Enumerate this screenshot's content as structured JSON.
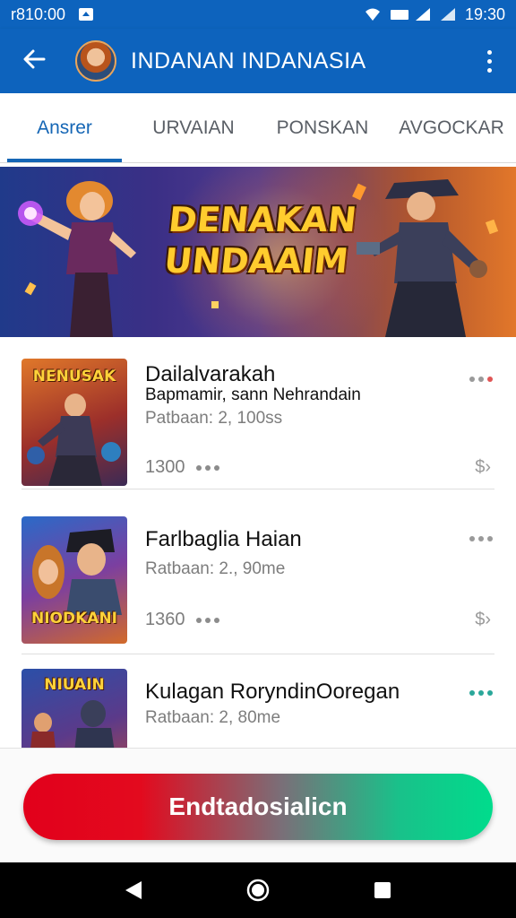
{
  "status_bar": {
    "time_left": "r810:00",
    "time_right": "19:30"
  },
  "app_bar": {
    "title": "INDANAN  INDANASIA"
  },
  "tabs": [
    {
      "label": "Ansrer"
    },
    {
      "label": "URVAIAN"
    },
    {
      "label": "PONSKAN"
    },
    {
      "label": "AVGOCKAR"
    }
  ],
  "banner": {
    "title_line1": "DENAKAN",
    "title_line2": "UNDAAIM"
  },
  "items": [
    {
      "thumb_title": "NENUSAK",
      "name": "Dailalvarakah",
      "subtitle": "Bapmamir, sann Nehrandain",
      "meta": "Patbaan: 2, 100ss",
      "count": "1300",
      "price_symbol": "$",
      "menu_color": "#e05555"
    },
    {
      "thumb_title": "NIODKANI",
      "name": "Farlbaglia Haian",
      "subtitle": "",
      "meta": "Ratbaan: 2., 90me",
      "count": "1360",
      "price_symbol": "$",
      "menu_color": "#9a9a9a"
    },
    {
      "thumb_title": "NIUAIN",
      "name": "Kulagan RoryndinOoregan",
      "subtitle": "",
      "meta": "Ratbaan: 2, 80me",
      "count": "",
      "price_symbol": "",
      "menu_color": "#2aa79a"
    }
  ],
  "cta": {
    "label": "Endtadosialicn"
  },
  "colors": {
    "primary": "#0d63bd",
    "cta_start": "#e2001b",
    "cta_end": "#00dc8c"
  },
  "icons": [
    "back-arrow-icon",
    "more-vert-icon",
    "wifi-icon",
    "signal-icon",
    "battery-icon",
    "nav-back-icon",
    "nav-home-icon",
    "nav-recents-icon"
  ]
}
